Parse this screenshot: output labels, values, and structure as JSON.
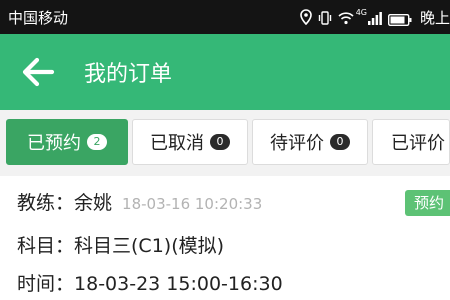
{
  "status_bar": {
    "carrier": "中国移动",
    "network_type": "4G",
    "time": "晚上",
    "icons": [
      "location-icon",
      "vibrate-icon",
      "wifi-icon",
      "signal-icon",
      "battery-icon"
    ]
  },
  "app_bar": {
    "title": "我的订单",
    "back_icon": "arrow-left-icon",
    "background": "#35b877"
  },
  "tabs": [
    {
      "label": "已预约",
      "count": "2",
      "active": true
    },
    {
      "label": "已取消",
      "count": "0",
      "active": false
    },
    {
      "label": "待评价",
      "count": "0",
      "active": false
    },
    {
      "label": "已评价",
      "count": "",
      "active": false
    }
  ],
  "order": {
    "coach_label": "教练：",
    "coach_name": "余姚",
    "booked_at": "18-03-16 10:20:33",
    "status": "预约",
    "subject_label": "科目：",
    "subject": "科目三(C1)(模拟)",
    "time_label": "时间：",
    "time": "18-03-23 15:00-16:30"
  },
  "colors": {
    "primary": "#35b877",
    "tab_active": "#3aa563",
    "status_badge": "#5dc275",
    "status_bar": "#141414",
    "muted_text": "#b3b3b3"
  }
}
